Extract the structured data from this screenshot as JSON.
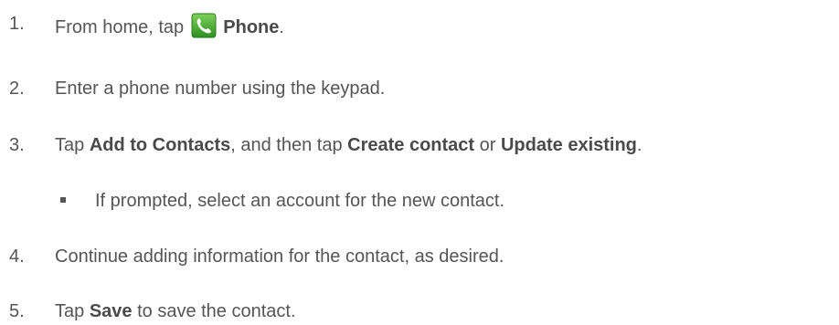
{
  "steps": [
    {
      "number": "1.",
      "text_before": "From home, tap ",
      "bold": "Phone",
      "text_after": ".",
      "icon": "phone-app-icon"
    },
    {
      "number": "2.",
      "text": "Enter a phone number using the keypad."
    },
    {
      "number": "3.",
      "part1": "Tap ",
      "bold1": "Add to Contacts",
      "part2": ", and then tap ",
      "bold2": "Create contact",
      "part3": " or ",
      "bold3": "Update existing",
      "part4": ".",
      "bullet": "If prompted, select an account for the new contact."
    },
    {
      "number": "4.",
      "text": "Continue adding information for the contact, as desired."
    },
    {
      "number": "5.",
      "part1": "Tap ",
      "bold1": "Save",
      "part2": " to save the contact."
    }
  ],
  "colors": {
    "text": "#555555",
    "icon_background": "#3aa12a"
  }
}
